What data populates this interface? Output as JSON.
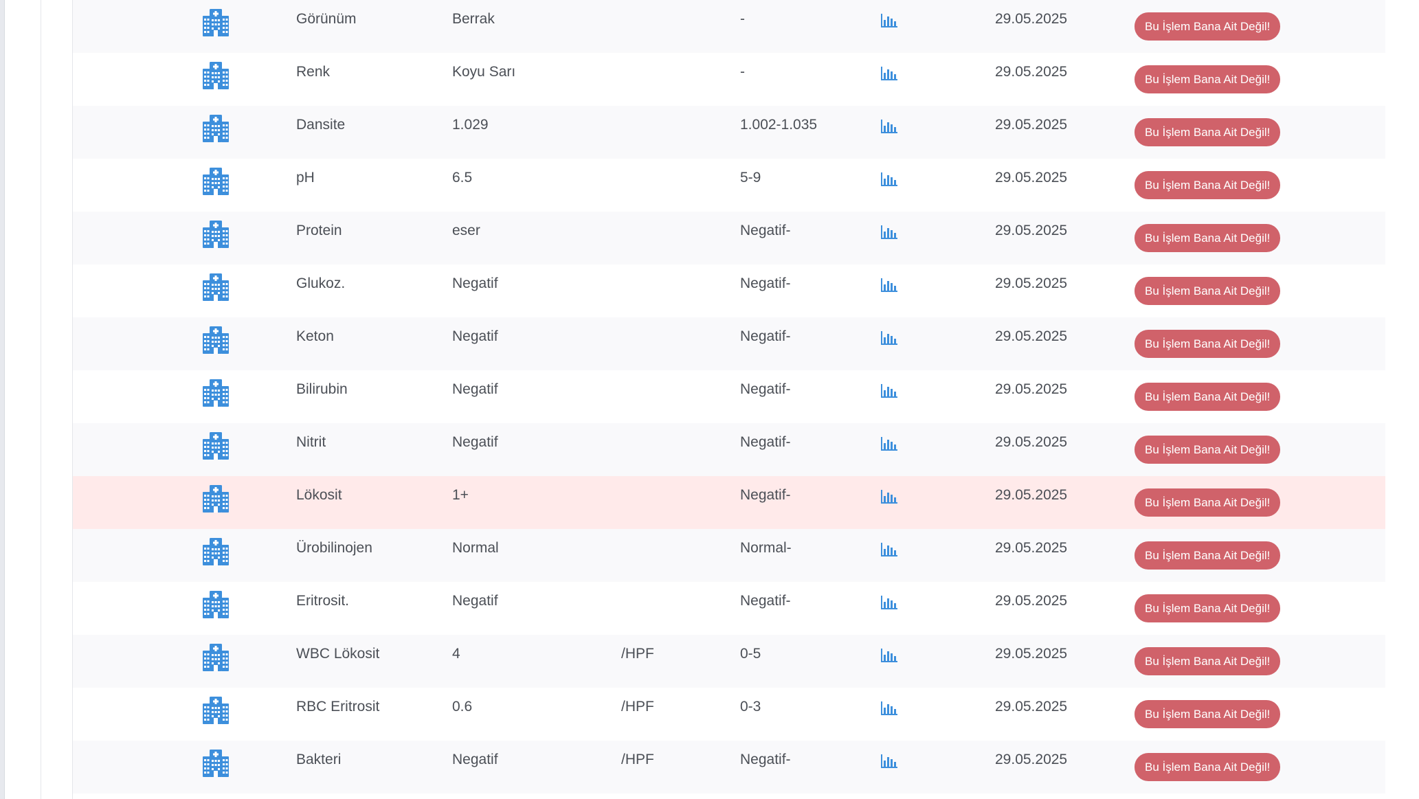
{
  "colors": {
    "accent_blue": "#3d8fdc",
    "danger_button": "#d0626a",
    "highlight_row": "#ffeaea"
  },
  "rows": [
    {
      "icon": "hospital-building-icon",
      "name": "Görünüm",
      "value": "Berrak",
      "unit": "",
      "reference": "-",
      "chart_icon": "bar-chart-icon",
      "date": "29.05.2025",
      "action": "Bu İşlem Bana Ait Değil!",
      "highlighted": false
    },
    {
      "icon": "hospital-building-icon",
      "name": "Renk",
      "value": "Koyu Sarı",
      "unit": "",
      "reference": "-",
      "chart_icon": "bar-chart-icon",
      "date": "29.05.2025",
      "action": "Bu İşlem Bana Ait Değil!",
      "highlighted": false
    },
    {
      "icon": "hospital-building-icon",
      "name": "Dansite",
      "value": "1.029",
      "unit": "",
      "reference": "1.002-1.035",
      "chart_icon": "bar-chart-icon",
      "date": "29.05.2025",
      "action": "Bu İşlem Bana Ait Değil!",
      "highlighted": false
    },
    {
      "icon": "hospital-building-icon",
      "name": "pH",
      "value": "6.5",
      "unit": "",
      "reference": "5-9",
      "chart_icon": "bar-chart-icon",
      "date": "29.05.2025",
      "action": "Bu İşlem Bana Ait Değil!",
      "highlighted": false
    },
    {
      "icon": "hospital-building-icon",
      "name": "Protein",
      "value": "eser",
      "unit": "",
      "reference": "Negatif-",
      "chart_icon": "bar-chart-icon",
      "date": "29.05.2025",
      "action": "Bu İşlem Bana Ait Değil!",
      "highlighted": false
    },
    {
      "icon": "hospital-building-icon",
      "name": "Glukoz.",
      "value": "Negatif",
      "unit": "",
      "reference": "Negatif-",
      "chart_icon": "bar-chart-icon",
      "date": "29.05.2025",
      "action": "Bu İşlem Bana Ait Değil!",
      "highlighted": false
    },
    {
      "icon": "hospital-building-icon",
      "name": "Keton",
      "value": "Negatif",
      "unit": "",
      "reference": "Negatif-",
      "chart_icon": "bar-chart-icon",
      "date": "29.05.2025",
      "action": "Bu İşlem Bana Ait Değil!",
      "highlighted": false
    },
    {
      "icon": "hospital-building-icon",
      "name": "Bilirubin",
      "value": "Negatif",
      "unit": "",
      "reference": "Negatif-",
      "chart_icon": "bar-chart-icon",
      "date": "29.05.2025",
      "action": "Bu İşlem Bana Ait Değil!",
      "highlighted": false
    },
    {
      "icon": "hospital-building-icon",
      "name": "Nitrit",
      "value": "Negatif",
      "unit": "",
      "reference": "Negatif-",
      "chart_icon": "bar-chart-icon",
      "date": "29.05.2025",
      "action": "Bu İşlem Bana Ait Değil!",
      "highlighted": false
    },
    {
      "icon": "hospital-building-icon",
      "name": "Lökosit",
      "value": "1+",
      "unit": "",
      "reference": "Negatif-",
      "chart_icon": "bar-chart-icon",
      "date": "29.05.2025",
      "action": "Bu İşlem Bana Ait Değil!",
      "highlighted": true
    },
    {
      "icon": "hospital-building-icon",
      "name": "Ürobilinojen",
      "value": "Normal",
      "unit": "",
      "reference": "Normal-",
      "chart_icon": "bar-chart-icon",
      "date": "29.05.2025",
      "action": "Bu İşlem Bana Ait Değil!",
      "highlighted": false
    },
    {
      "icon": "hospital-building-icon",
      "name": "Eritrosit.",
      "value": "Negatif",
      "unit": "",
      "reference": "Negatif-",
      "chart_icon": "bar-chart-icon",
      "date": "29.05.2025",
      "action": "Bu İşlem Bana Ait Değil!",
      "highlighted": false
    },
    {
      "icon": "hospital-building-icon",
      "name": "WBC Lökosit",
      "value": "4",
      "unit": "/HPF",
      "reference": "0-5",
      "chart_icon": "bar-chart-icon",
      "date": "29.05.2025",
      "action": "Bu İşlem Bana Ait Değil!",
      "highlighted": false
    },
    {
      "icon": "hospital-building-icon",
      "name": "RBC Eritrosit",
      "value": "0.6",
      "unit": "/HPF",
      "reference": "0-3",
      "chart_icon": "bar-chart-icon",
      "date": "29.05.2025",
      "action": "Bu İşlem Bana Ait Değil!",
      "highlighted": false
    },
    {
      "icon": "hospital-building-icon",
      "name": "Bakteri",
      "value": "Negatif",
      "unit": "/HPF",
      "reference": "Negatif-",
      "chart_icon": "bar-chart-icon",
      "date": "29.05.2025",
      "action": "Bu İşlem Bana Ait Değil!",
      "highlighted": false
    }
  ]
}
